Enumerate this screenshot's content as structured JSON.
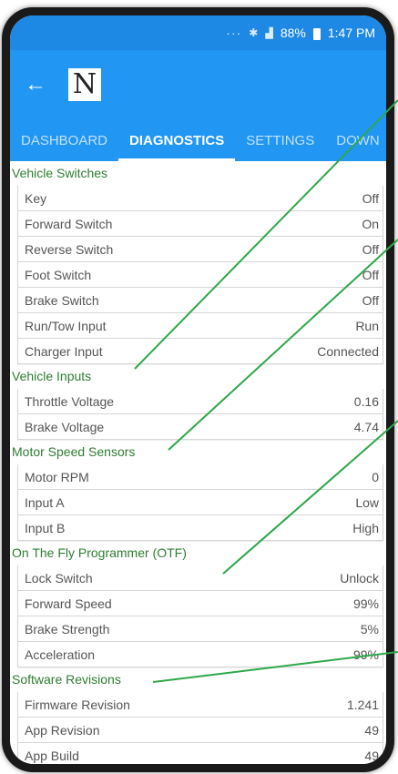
{
  "status_bar": {
    "dots": "···",
    "bluetooth": "✱",
    "signal": "▟",
    "battery": "88%",
    "time": "1:47 PM"
  },
  "app_bar": {
    "logo_letter": "N"
  },
  "tabs": [
    {
      "label": "DASHBOARD",
      "active": false
    },
    {
      "label": "DIAGNOSTICS",
      "active": true
    },
    {
      "label": "SETTINGS",
      "active": false
    },
    {
      "label": "DOWN",
      "active": false
    }
  ],
  "sections": [
    {
      "title": "Vehicle Switches",
      "rows": [
        {
          "label": "Key",
          "value": "Off"
        },
        {
          "label": "Forward Switch",
          "value": "On"
        },
        {
          "label": "Reverse Switch",
          "value": "Off"
        },
        {
          "label": "Foot Switch",
          "value": "Off"
        },
        {
          "label": "Brake Switch",
          "value": "Off"
        },
        {
          "label": "Run/Tow Input",
          "value": "Run"
        },
        {
          "label": "Charger Input",
          "value": "Connected"
        }
      ]
    },
    {
      "title": "Vehicle Inputs",
      "rows": [
        {
          "label": "Throttle Voltage",
          "value": "0.16"
        },
        {
          "label": "Brake Voltage",
          "value": "4.74"
        }
      ]
    },
    {
      "title": "Motor Speed Sensors",
      "rows": [
        {
          "label": "Motor RPM",
          "value": "0"
        },
        {
          "label": "Input A",
          "value": "Low"
        },
        {
          "label": "Input B",
          "value": "High"
        }
      ]
    },
    {
      "title": "On The Fly Programmer (OTF)",
      "rows": [
        {
          "label": "Lock Switch",
          "value": "Unlock"
        },
        {
          "label": "Forward Speed",
          "value": "99%"
        },
        {
          "label": "Brake Strength",
          "value": "5%"
        },
        {
          "label": "Acceleration",
          "value": "99%"
        }
      ]
    },
    {
      "title": "Software Revisions",
      "rows": [
        {
          "label": "Firmware Revision",
          "value": "1.241"
        },
        {
          "label": "App Revision",
          "value": "49"
        },
        {
          "label": "App Build",
          "value": "49"
        }
      ]
    }
  ],
  "colors": {
    "primary": "#2196f3",
    "status_bar": "#1e88e5",
    "section_title": "#2e7d32",
    "callout_line": "#2ea84a"
  }
}
